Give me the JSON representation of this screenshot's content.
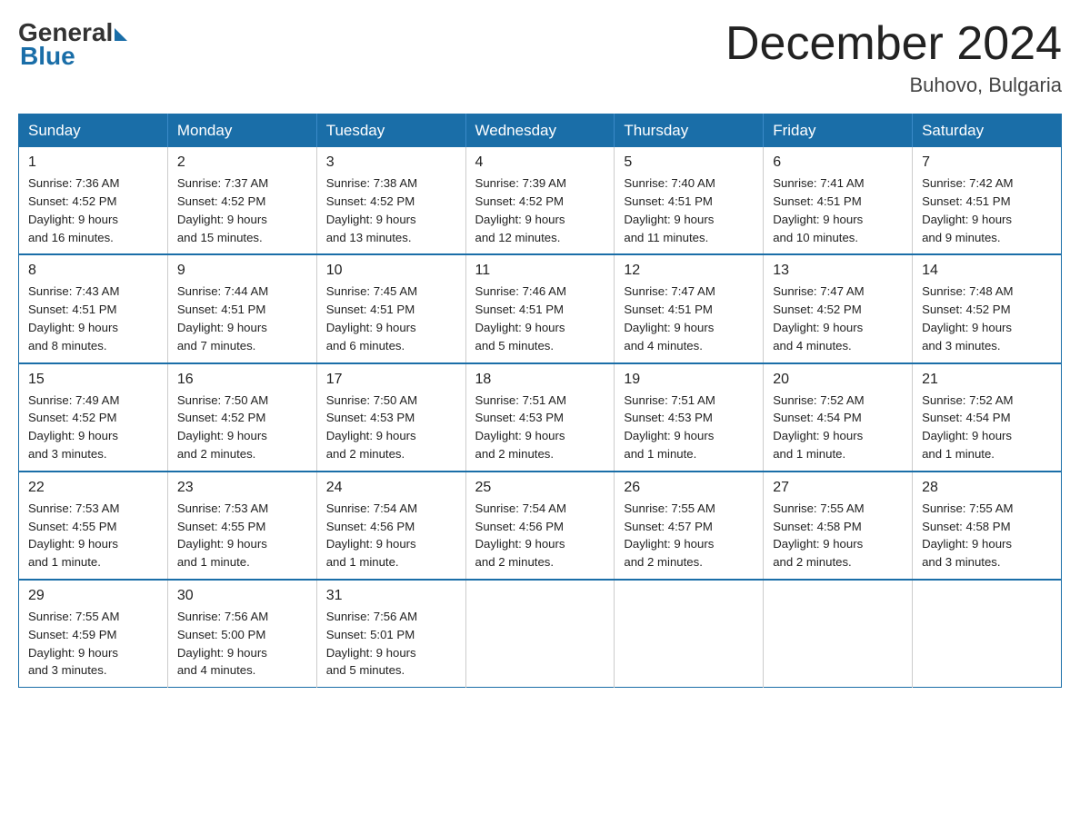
{
  "logo": {
    "general": "General",
    "blue": "Blue"
  },
  "title": "December 2024",
  "location": "Buhovo, Bulgaria",
  "days_of_week": [
    "Sunday",
    "Monday",
    "Tuesday",
    "Wednesday",
    "Thursday",
    "Friday",
    "Saturday"
  ],
  "weeks": [
    [
      {
        "day": "1",
        "sunrise": "7:36 AM",
        "sunset": "4:52 PM",
        "daylight": "9 hours and 16 minutes."
      },
      {
        "day": "2",
        "sunrise": "7:37 AM",
        "sunset": "4:52 PM",
        "daylight": "9 hours and 15 minutes."
      },
      {
        "day": "3",
        "sunrise": "7:38 AM",
        "sunset": "4:52 PM",
        "daylight": "9 hours and 13 minutes."
      },
      {
        "day": "4",
        "sunrise": "7:39 AM",
        "sunset": "4:52 PM",
        "daylight": "9 hours and 12 minutes."
      },
      {
        "day": "5",
        "sunrise": "7:40 AM",
        "sunset": "4:51 PM",
        "daylight": "9 hours and 11 minutes."
      },
      {
        "day": "6",
        "sunrise": "7:41 AM",
        "sunset": "4:51 PM",
        "daylight": "9 hours and 10 minutes."
      },
      {
        "day": "7",
        "sunrise": "7:42 AM",
        "sunset": "4:51 PM",
        "daylight": "9 hours and 9 minutes."
      }
    ],
    [
      {
        "day": "8",
        "sunrise": "7:43 AM",
        "sunset": "4:51 PM",
        "daylight": "9 hours and 8 minutes."
      },
      {
        "day": "9",
        "sunrise": "7:44 AM",
        "sunset": "4:51 PM",
        "daylight": "9 hours and 7 minutes."
      },
      {
        "day": "10",
        "sunrise": "7:45 AM",
        "sunset": "4:51 PM",
        "daylight": "9 hours and 6 minutes."
      },
      {
        "day": "11",
        "sunrise": "7:46 AM",
        "sunset": "4:51 PM",
        "daylight": "9 hours and 5 minutes."
      },
      {
        "day": "12",
        "sunrise": "7:47 AM",
        "sunset": "4:51 PM",
        "daylight": "9 hours and 4 minutes."
      },
      {
        "day": "13",
        "sunrise": "7:47 AM",
        "sunset": "4:52 PM",
        "daylight": "9 hours and 4 minutes."
      },
      {
        "day": "14",
        "sunrise": "7:48 AM",
        "sunset": "4:52 PM",
        "daylight": "9 hours and 3 minutes."
      }
    ],
    [
      {
        "day": "15",
        "sunrise": "7:49 AM",
        "sunset": "4:52 PM",
        "daylight": "9 hours and 3 minutes."
      },
      {
        "day": "16",
        "sunrise": "7:50 AM",
        "sunset": "4:52 PM",
        "daylight": "9 hours and 2 minutes."
      },
      {
        "day": "17",
        "sunrise": "7:50 AM",
        "sunset": "4:53 PM",
        "daylight": "9 hours and 2 minutes."
      },
      {
        "day": "18",
        "sunrise": "7:51 AM",
        "sunset": "4:53 PM",
        "daylight": "9 hours and 2 minutes."
      },
      {
        "day": "19",
        "sunrise": "7:51 AM",
        "sunset": "4:53 PM",
        "daylight": "9 hours and 1 minute."
      },
      {
        "day": "20",
        "sunrise": "7:52 AM",
        "sunset": "4:54 PM",
        "daylight": "9 hours and 1 minute."
      },
      {
        "day": "21",
        "sunrise": "7:52 AM",
        "sunset": "4:54 PM",
        "daylight": "9 hours and 1 minute."
      }
    ],
    [
      {
        "day": "22",
        "sunrise": "7:53 AM",
        "sunset": "4:55 PM",
        "daylight": "9 hours and 1 minute."
      },
      {
        "day": "23",
        "sunrise": "7:53 AM",
        "sunset": "4:55 PM",
        "daylight": "9 hours and 1 minute."
      },
      {
        "day": "24",
        "sunrise": "7:54 AM",
        "sunset": "4:56 PM",
        "daylight": "9 hours and 1 minute."
      },
      {
        "day": "25",
        "sunrise": "7:54 AM",
        "sunset": "4:56 PM",
        "daylight": "9 hours and 2 minutes."
      },
      {
        "day": "26",
        "sunrise": "7:55 AM",
        "sunset": "4:57 PM",
        "daylight": "9 hours and 2 minutes."
      },
      {
        "day": "27",
        "sunrise": "7:55 AM",
        "sunset": "4:58 PM",
        "daylight": "9 hours and 2 minutes."
      },
      {
        "day": "28",
        "sunrise": "7:55 AM",
        "sunset": "4:58 PM",
        "daylight": "9 hours and 3 minutes."
      }
    ],
    [
      {
        "day": "29",
        "sunrise": "7:55 AM",
        "sunset": "4:59 PM",
        "daylight": "9 hours and 3 minutes."
      },
      {
        "day": "30",
        "sunrise": "7:56 AM",
        "sunset": "5:00 PM",
        "daylight": "9 hours and 4 minutes."
      },
      {
        "day": "31",
        "sunrise": "7:56 AM",
        "sunset": "5:01 PM",
        "daylight": "9 hours and 5 minutes."
      },
      null,
      null,
      null,
      null
    ]
  ],
  "labels": {
    "sunrise": "Sunrise:",
    "sunset": "Sunset:",
    "daylight": "Daylight:"
  }
}
